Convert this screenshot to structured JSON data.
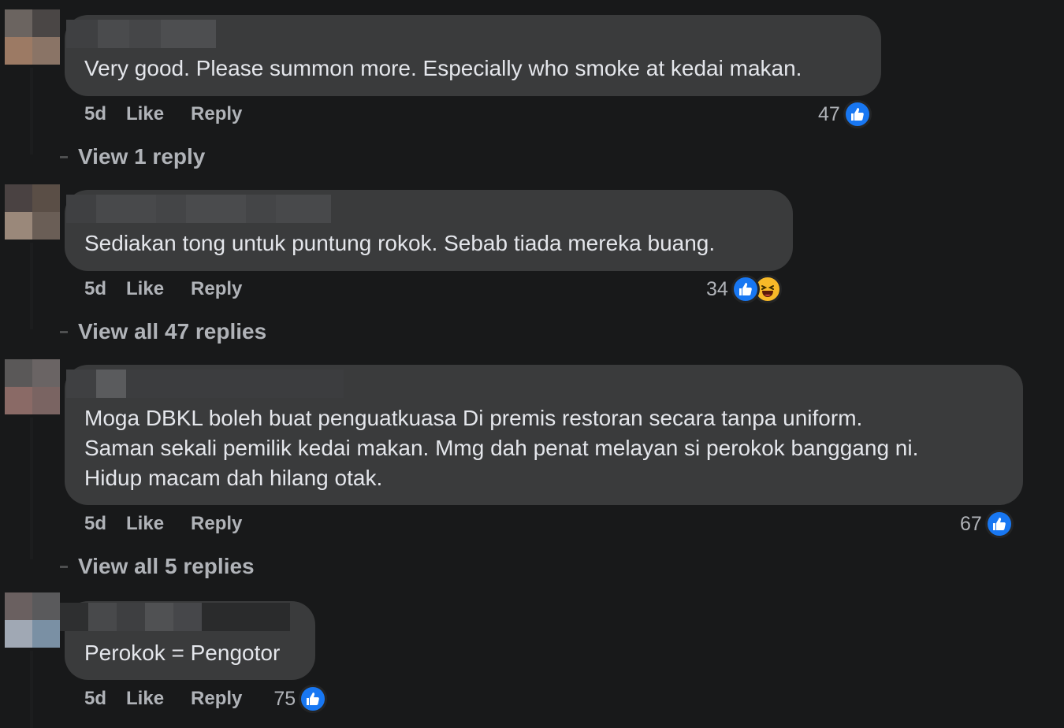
{
  "comments": [
    {
      "text": "Very good. Please summon more. Especially who smoke at kedai makan.",
      "time": "5d",
      "like_label": "Like",
      "reply_label": "Reply",
      "reaction_count": "47",
      "reactions": [
        "like-icon"
      ],
      "view_replies": "View 1 reply"
    },
    {
      "text": "Sediakan tong untuk puntung rokok. Sebab tiada mereka buang.",
      "time": "5d",
      "like_label": "Like",
      "reply_label": "Reply",
      "reaction_count": "34",
      "reactions": [
        "like-icon",
        "haha-icon"
      ],
      "view_replies": "View all 47 replies"
    },
    {
      "text": "Moga DBKL boleh buat penguatkuasa Di premis restoran secara tanpa uniform.\nSaman sekali pemilik kedai makan. Mmg dah penat melayan si perokok banggang ni.\nHidup macam dah hilang otak.",
      "time": "5d",
      "like_label": "Like",
      "reply_label": "Reply",
      "reaction_count": "67",
      "reactions": [
        "like-icon"
      ],
      "view_replies": "View all 5 replies"
    },
    {
      "text": "Perokok = Pengotor",
      "time": "5d",
      "like_label": "Like",
      "reply_label": "Reply",
      "reaction_count": "75",
      "reactions": [
        "like-icon"
      ]
    }
  ],
  "colors": {
    "background": "#18191a",
    "bubble": "#3a3b3c",
    "text": "#e4e6eb",
    "secondary_text": "#b0b3b8",
    "like_blue": "#1877f2",
    "haha_yellow": "#f7b928"
  }
}
